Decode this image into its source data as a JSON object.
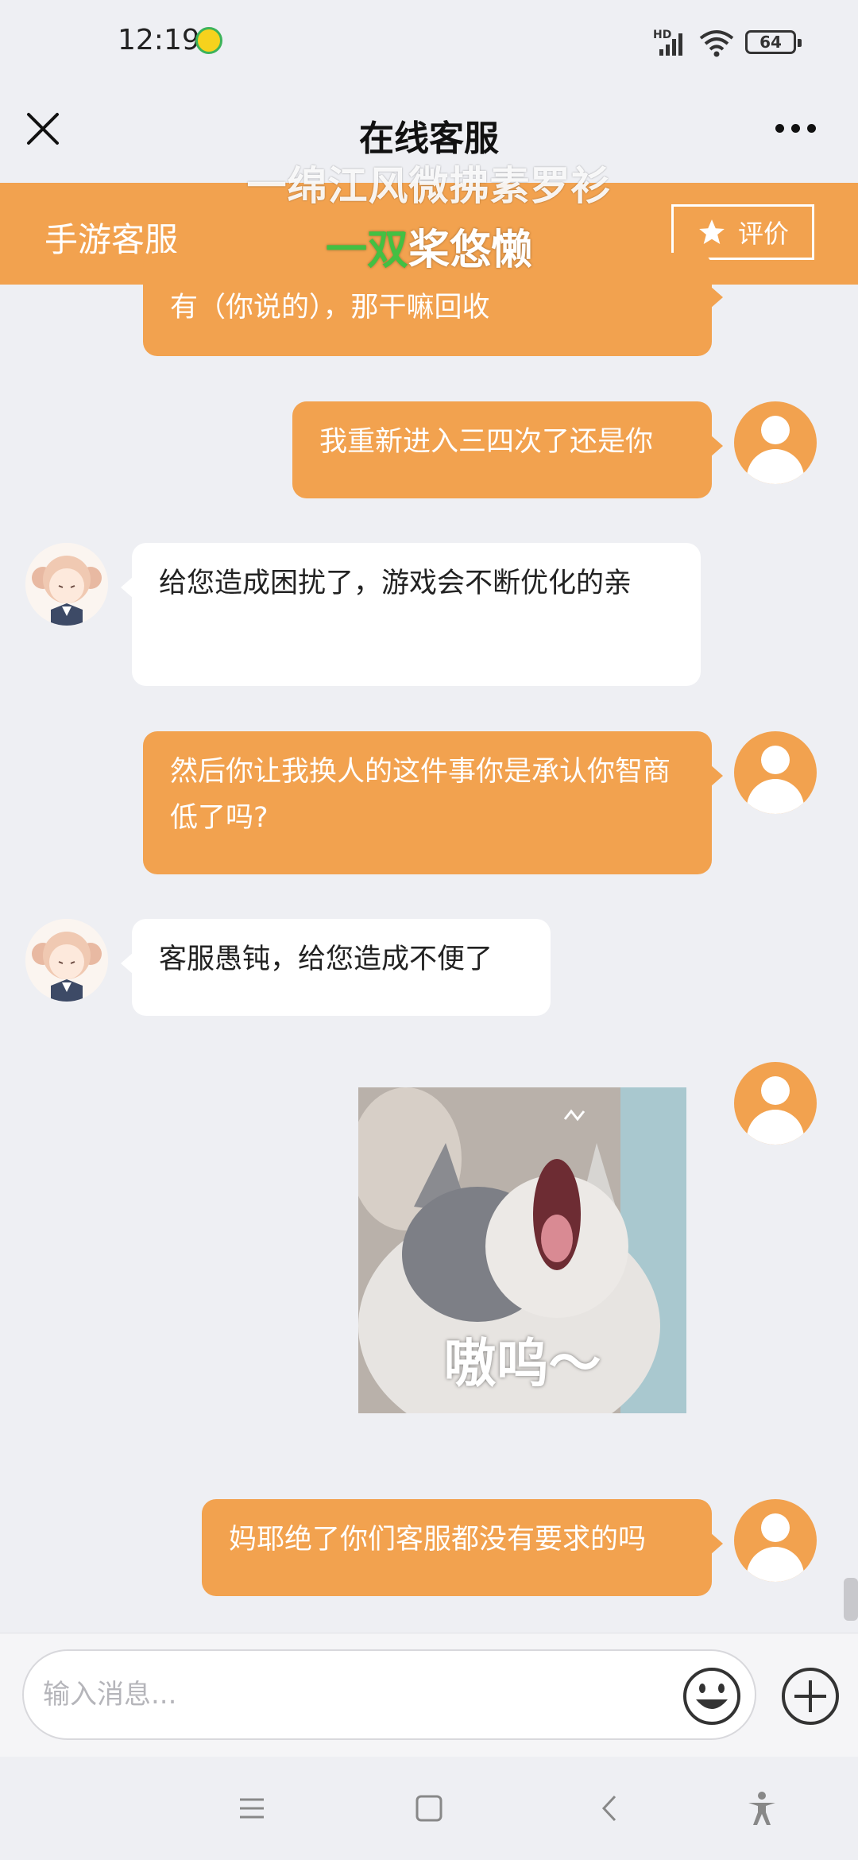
{
  "status_bar": {
    "time": "12:19",
    "network": "HD",
    "battery": "64"
  },
  "nav": {
    "title": "在线客服"
  },
  "header": {
    "service_name": "手游客服",
    "rate_label": "评价"
  },
  "lyrics": {
    "line1": "一绵江风微拂素罗衫",
    "line2_highlight": "一双",
    "line2_rest": "桨悠懒"
  },
  "messages": [
    {
      "from": "user",
      "text": "有（你说的），那干嘛回收"
    },
    {
      "from": "user",
      "text": "我重新进入三四次了还是你"
    },
    {
      "from": "agent",
      "text": "给您造成困扰了，游戏会不断优化的亲"
    },
    {
      "from": "user",
      "text": "然后你让我换人的这件事你是承认你智商低了吗?"
    },
    {
      "from": "agent",
      "text": "客服愚钝，给您造成不便了"
    },
    {
      "from": "user",
      "type": "image",
      "caption": "嗷呜～"
    },
    {
      "from": "user",
      "text": "妈耶绝了你们客服都没有要求的吗"
    }
  ],
  "input": {
    "placeholder": "输入消息..."
  },
  "icons": {
    "close": "close-icon",
    "more": "more-icon",
    "star": "star-icon",
    "emoji": "emoji-icon",
    "plus": "plus-icon",
    "menu": "menu-icon",
    "home": "home-icon",
    "back": "back-icon",
    "accessibility": "accessibility-icon"
  },
  "colors": {
    "accent": "#f2a24f",
    "background": "#eeeff3",
    "incoming_bubble": "#ffffff"
  }
}
